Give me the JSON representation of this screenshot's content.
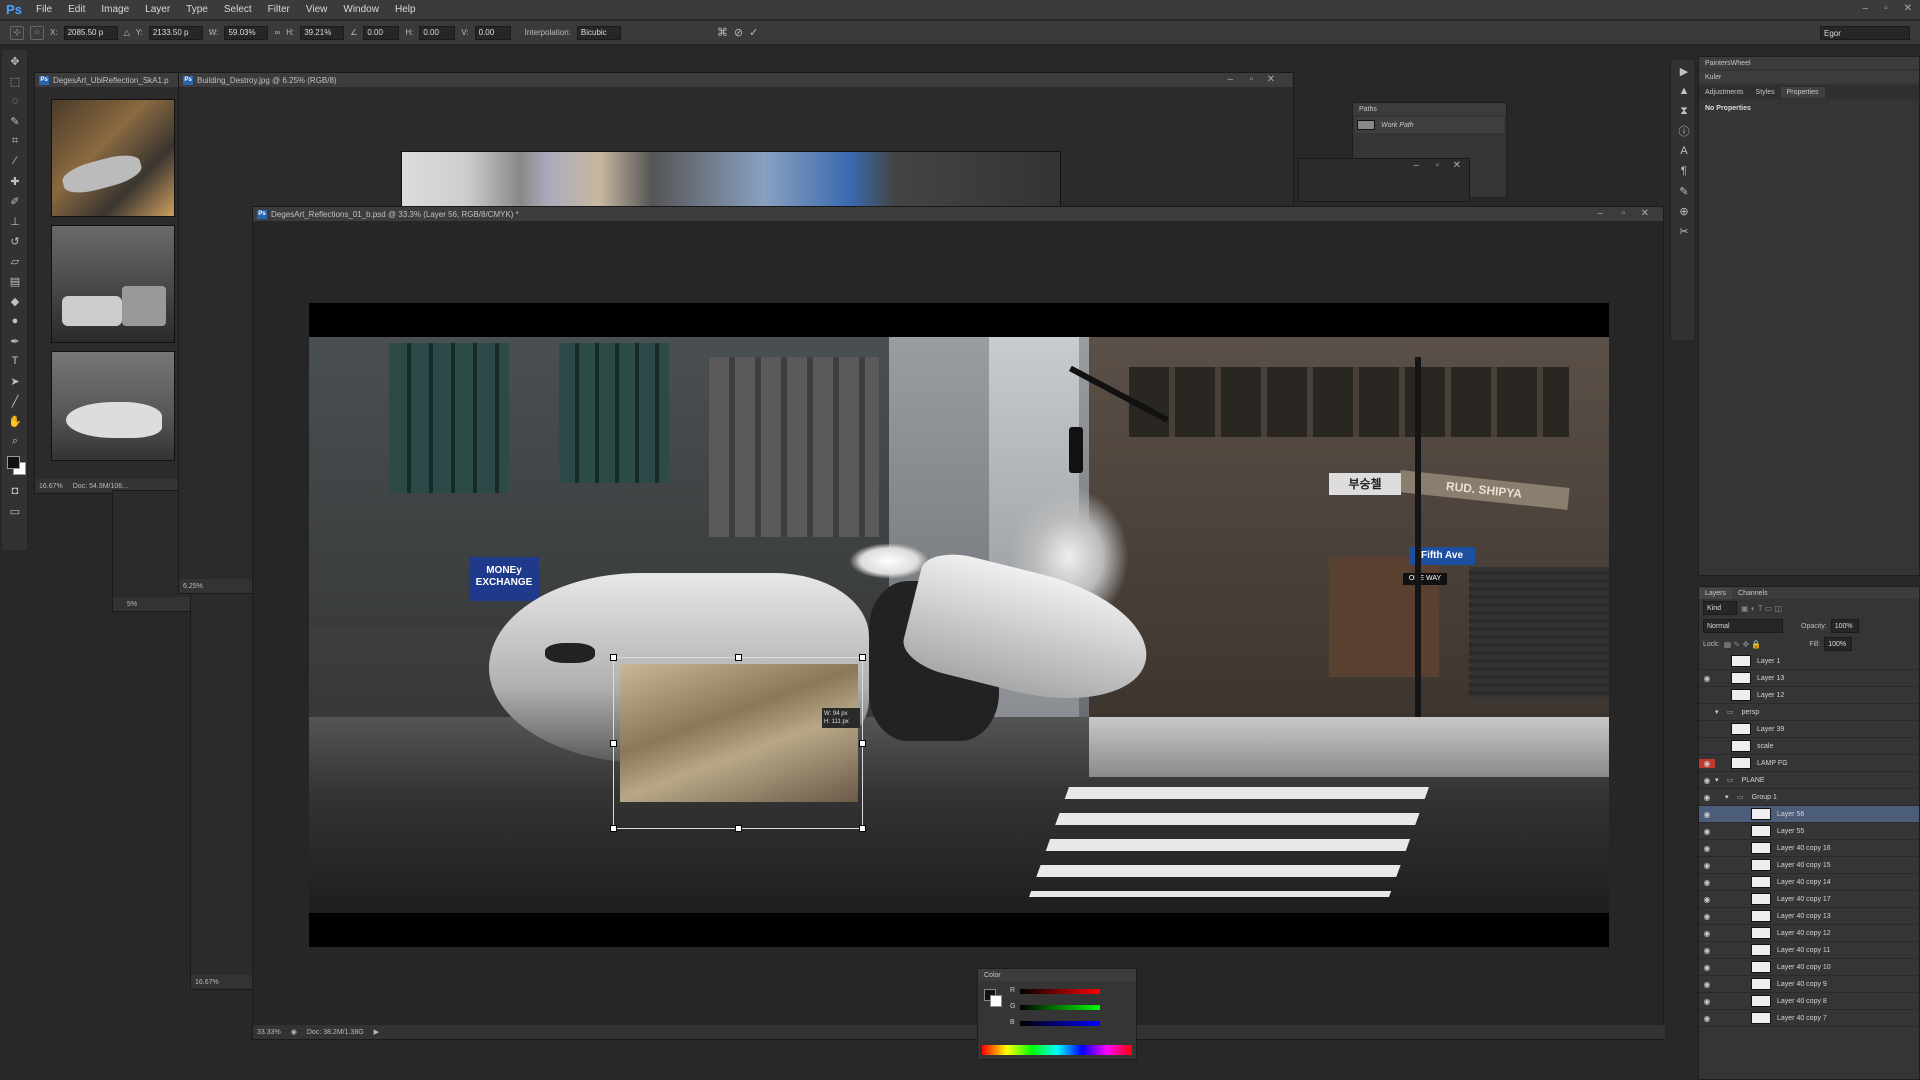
{
  "app": {
    "logo": "Ps",
    "menu": [
      "File",
      "Edit",
      "Image",
      "Layer",
      "Type",
      "Select",
      "Filter",
      "View",
      "Window",
      "Help"
    ],
    "window_controls": [
      "–",
      "▫",
      "✕"
    ]
  },
  "options_bar": {
    "x_label": "X:",
    "x_value": "2085.50 p",
    "y_label": "Y:",
    "y_value": "2133.50 p",
    "w_label": "W:",
    "w_value": "59.03%",
    "h_label": "H:",
    "h_value": "39.21%",
    "angle_value": "0.00",
    "hskew_label": "H:",
    "hskew_value": "0.00",
    "vskew_label": "V:",
    "vskew_value": "0.00",
    "interp_label": "Interpolation:",
    "interp_value": "Bicubic",
    "workspace": "Egor"
  },
  "documents": {
    "ref_small": {
      "title": "DegesArt_UbiReflection_SkA1.p",
      "zoom": "16.67%",
      "doc": "Doc: 54.9M/106..."
    },
    "building": {
      "title": "Building_Destroy.jpg @ 6.25% (RGB/8)",
      "zoom": "6.25%"
    },
    "small_a": {
      "zoom": "5%"
    },
    "small_b": {
      "zoom": "16.67%"
    },
    "main": {
      "title": "DegesArt_Reflections_01_b.psd @ 33.3% (Layer 56, RGB/8/CMYK) *",
      "zoom": "33.33%",
      "doc": "Doc: 38.2M/1.38G"
    }
  },
  "canvas": {
    "signs": {
      "money": "MONEy\nEXCHANGE",
      "fifth_ave": "Fifth Ave",
      "rud": "RUD. SHIPYA",
      "korean": "부숭첼",
      "oneway": "ONE WAY"
    },
    "transform_readout": "W: 94 px\nH: 111 px"
  },
  "paths_panel": {
    "tab": "Paths",
    "item": "Work Path"
  },
  "color_panel": {
    "tab": "Color",
    "labels": [
      "R",
      "G",
      "B"
    ]
  },
  "right_panel": {
    "top_tabs": [
      "PaintersWheel",
      "Kuler"
    ],
    "prop_tabs": [
      "Adjustments",
      "Styles",
      "Properties"
    ],
    "no_properties": "No Properties"
  },
  "layers_panel": {
    "tabs": [
      "Layers",
      "Channels"
    ],
    "kind": "Kind",
    "blend_mode": "Normal",
    "opacity_label": "Opacity:",
    "opacity": "100%",
    "lock_label": "Lock:",
    "fill_label": "Fill:",
    "fill": "100%",
    "layers": [
      {
        "name": "Layer 1",
        "indent": 0,
        "visible": false,
        "selected": false,
        "folder": false
      },
      {
        "name": "Layer 13",
        "indent": 0,
        "visible": true,
        "selected": false,
        "folder": false
      },
      {
        "name": "Layer 12",
        "indent": 0,
        "visible": false,
        "selected": false,
        "folder": false
      },
      {
        "name": "persp",
        "indent": 0,
        "visible": false,
        "selected": false,
        "folder": true
      },
      {
        "name": "Layer 39",
        "indent": 0,
        "visible": false,
        "selected": false,
        "folder": false
      },
      {
        "name": "scale",
        "indent": 0,
        "visible": false,
        "selected": false,
        "folder": false
      },
      {
        "name": "LAMP FG",
        "indent": 0,
        "visible": true,
        "selected": false,
        "folder": false
      },
      {
        "name": "PLANE",
        "indent": 0,
        "visible": true,
        "selected": false,
        "folder": true
      },
      {
        "name": "Group 1",
        "indent": 1,
        "visible": true,
        "selected": false,
        "folder": true
      },
      {
        "name": "Layer 56",
        "indent": 2,
        "visible": true,
        "selected": true,
        "folder": false
      },
      {
        "name": "Layer 55",
        "indent": 2,
        "visible": true,
        "selected": false,
        "folder": false
      },
      {
        "name": "Layer 40 copy 16",
        "indent": 2,
        "visible": true,
        "selected": false,
        "folder": false
      },
      {
        "name": "Layer 40 copy 15",
        "indent": 2,
        "visible": true,
        "selected": false,
        "folder": false
      },
      {
        "name": "Layer 40 copy 14",
        "indent": 2,
        "visible": true,
        "selected": false,
        "folder": false
      },
      {
        "name": "Layer 40 copy 17",
        "indent": 2,
        "visible": true,
        "selected": false,
        "folder": false
      },
      {
        "name": "Layer 40 copy 13",
        "indent": 2,
        "visible": true,
        "selected": false,
        "folder": false
      },
      {
        "name": "Layer 40 copy 12",
        "indent": 2,
        "visible": true,
        "selected": false,
        "folder": false
      },
      {
        "name": "Layer 40 copy 11",
        "indent": 2,
        "visible": true,
        "selected": false,
        "folder": false
      },
      {
        "name": "Layer 40 copy 10",
        "indent": 2,
        "visible": true,
        "selected": false,
        "folder": false
      },
      {
        "name": "Layer 40 copy 9",
        "indent": 2,
        "visible": true,
        "selected": false,
        "folder": false
      },
      {
        "name": "Layer 40 copy 8",
        "indent": 2,
        "visible": true,
        "selected": false,
        "folder": false
      },
      {
        "name": "Layer 40 copy 7",
        "indent": 2,
        "visible": true,
        "selected": false,
        "folder": false
      }
    ]
  },
  "colors": {
    "accent": "#4aa3ff",
    "selected_row": "#4b5d79",
    "lamp_eye": "#c0392b"
  }
}
